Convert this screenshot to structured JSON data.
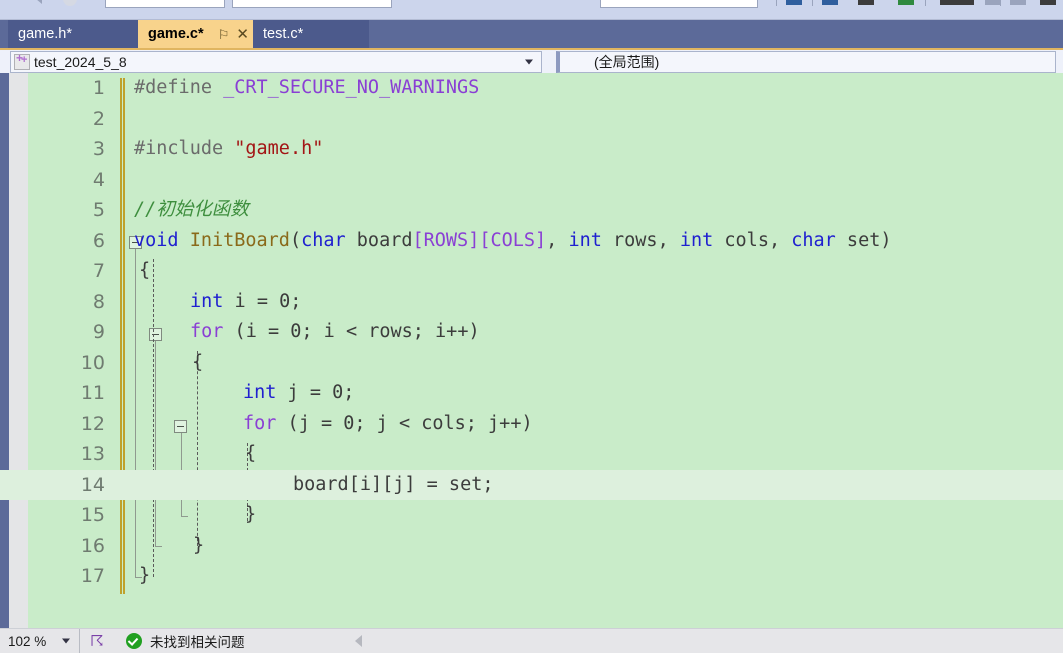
{
  "toolbar": {
    "icons": [
      {
        "name": "undo-arrow-icon"
      },
      {
        "name": "redo-circle-icon"
      },
      {
        "name": "config-combo"
      },
      {
        "name": "platform-combo"
      },
      {
        "name": "search-combo"
      },
      {
        "name": "pencil-icon"
      },
      {
        "name": "window-layout-icon"
      },
      {
        "name": "pointer-icon"
      },
      {
        "name": "add-icon"
      },
      {
        "name": "console-icon"
      },
      {
        "name": "panel-icon"
      },
      {
        "name": "list-icon"
      },
      {
        "name": "step-icon"
      }
    ]
  },
  "tabs": [
    {
      "label": "game.h*",
      "active": false
    },
    {
      "label": "game.c*",
      "active": true,
      "pin": "⚐",
      "close": "✕"
    },
    {
      "label": "test.c*",
      "active": false
    }
  ],
  "navbar": {
    "project": "test_2024_5_8",
    "scope": "(全局范围)"
  },
  "editor": {
    "background_color": "#c9ecc9",
    "current_line_color": "#ddf0dd",
    "change_bar_color": "#bfa12c",
    "lines": [
      {
        "n": "1",
        "current": false
      },
      {
        "n": "2",
        "current": false
      },
      {
        "n": "3",
        "current": false
      },
      {
        "n": "4",
        "current": false
      },
      {
        "n": "5",
        "current": false
      },
      {
        "n": "6",
        "current": false
      },
      {
        "n": "7",
        "current": false
      },
      {
        "n": "8",
        "current": false
      },
      {
        "n": "9",
        "current": false
      },
      {
        "n": "10",
        "current": false
      },
      {
        "n": "11",
        "current": false
      },
      {
        "n": "12",
        "current": false
      },
      {
        "n": "13",
        "current": false
      },
      {
        "n": "14",
        "current": true
      },
      {
        "n": "15",
        "current": false
      },
      {
        "n": "16",
        "current": false
      },
      {
        "n": "17",
        "current": false
      }
    ],
    "code": {
      "l1_define": "#define",
      "l1_macro": "_CRT_SECURE_NO_WARNINGS",
      "l3_include": "#include",
      "l3_header": "\"game.h\"",
      "l5_comment": "//初始化函数",
      "l6_void": "void",
      "l6_fn": "InitBoard",
      "l6_p1": "(",
      "l6_char1": "char",
      "l6_board": " board",
      "l6_lb1": "[",
      "l6_rows": "ROWS",
      "l6_rb1": "]",
      "l6_lb2": "[",
      "l6_cols": "COLS",
      "l6_rb2": "]",
      "l6_comma1": ", ",
      "l6_int1": "int",
      "l6_rows_p": " rows, ",
      "l6_int2": "int",
      "l6_cols_p": " cols, ",
      "l6_char2": "char",
      "l6_set": " set)",
      "l7_brace": "{",
      "l8_int": "int",
      "l8_rest": " i = 0;",
      "l9_for": "for",
      "l9_rest": " (i = 0; i < rows; i++)",
      "l10_brace": "{",
      "l11_int": "int",
      "l11_rest": " j = 0;",
      "l12_for": "for",
      "l12_rest": " (j = 0; j < cols; j++)",
      "l13_brace": "{",
      "l14_stmt": "board[i][j] = set;",
      "l15_brace": "}",
      "l16_brace": "}",
      "l17_brace": "}"
    }
  },
  "statusbar": {
    "zoom": "102 %",
    "spell_icon": "Ⓢ",
    "message": "未找到相关问题",
    "ok_status_color": "#21a021"
  }
}
